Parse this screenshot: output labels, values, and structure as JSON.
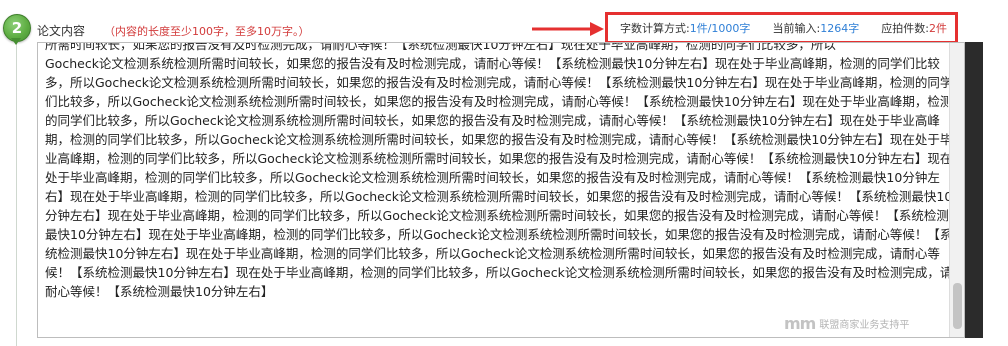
{
  "step": {
    "number": "2"
  },
  "field": {
    "label": "论文内容",
    "hint": "（内容的长度至少100字，至多10万字。）"
  },
  "stats": {
    "method_label": "字数计算方式:",
    "method_value": "1件/1000字",
    "current_label": "当前输入:",
    "current_value": "1264字",
    "pieces_label": "应拍件数:",
    "pieces_value": "2件"
  },
  "textarea": {
    "value": "所需时间较长，如果您的报告没有及时检测完成，请耐心等候！【系统检测最快10分钟左右】现在处于毕业高峰期，检测的同学们比较多，所以\nGocheck论文检测系统检测所需时间较长，如果您的报告没有及时检测完成，请耐心等候！【系统检测最快10分钟左右】现在处于毕业高峰期，检测的同学们比较多，所以Gocheck论文检测系统检测所需时间较长，如果您的报告没有及时检测完成，请耐心等候！【系统检测最快10分钟左右】现在处于毕业高峰期，检测的同学们比较多，所以Gocheck论文检测系统检测所需时间较长，如果您的报告没有及时检测完成，请耐心等候！【系统检测最快10分钟左右】现在处于毕业高峰期，检测的同学们比较多，所以Gocheck论文检测系统检测所需时间较长，如果您的报告没有及时检测完成，请耐心等候！【系统检测最快10分钟左右】现在处于毕业高峰期，检测的同学们比较多，所以Gocheck论文检测系统检测所需时间较长，如果您的报告没有及时检测完成，请耐心等候！【系统检测最快10分钟左右】现在处于毕业高峰期，检测的同学们比较多，所以Gocheck论文检测系统检测所需时间较长，如果您的报告没有及时检测完成，请耐心等候！【系统检测最快10分钟左右】现在处于毕业高峰期，检测的同学们比较多，所以Gocheck论文检测系统检测所需时间较长，如果您的报告没有及时检测完成，请耐心等候！【系统检测最快10分钟左右】现在处于毕业高峰期，检测的同学们比较多，所以Gocheck论文检测系统检测所需时间较长，如果您的报告没有及时检测完成，请耐心等候！【系统检测最快10分钟左右】现在处于毕业高峰期，检测的同学们比较多，所以Gocheck论文检测系统检测所需时间较长，如果您的报告没有及时检测完成，请耐心等候！【系统检测最快10分钟左右】现在处于毕业高峰期，检测的同学们比较多，所以Gocheck论文检测系统检测所需时间较长，如果您的报告没有及时检测完成，请耐心等候！【系统检测最快10分钟左右】现在处于毕业高峰期，检测的同学们比较多，所以Gocheck论文检测系统检测所需时间较长，如果您的报告没有及时检测完成，请耐心等候！【系统检测最快10分钟左右】现在处于毕业高峰期，检测的同学们比较多，所以Gocheck论文检测系统检测所需时间较长，如果您的报告没有及时检测完成，请耐心等候！【系统检测最快10分钟左右】"
  },
  "watermark": {
    "logo": "mm",
    "text": "联盟商家业务支持平"
  },
  "colors": {
    "highlight_border": "#e53030",
    "hint_red": "#d23a3a",
    "value_blue": "#2f7fd6",
    "badge_green": "#5fae43"
  },
  "icons": {
    "step_badge": "step-number-badge",
    "annotation_arrow": "red-arrow-icon"
  }
}
